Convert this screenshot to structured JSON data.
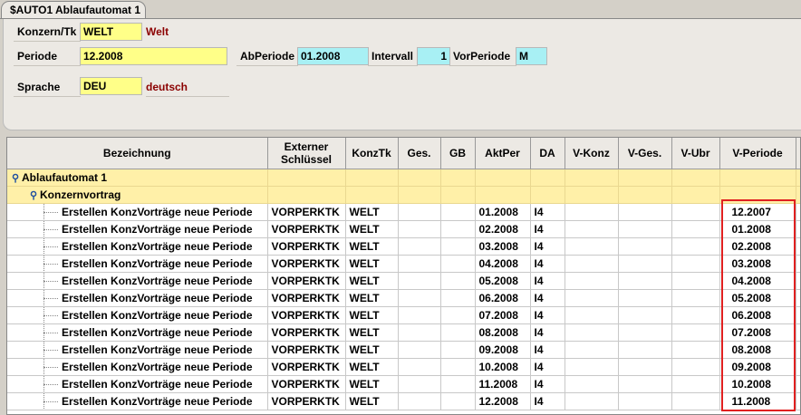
{
  "tab": {
    "title": "$AUTO1 Ablaufautomat 1"
  },
  "form": {
    "konzern": {
      "label": "Konzern/Tk",
      "value": "WELT",
      "desc": "Welt"
    },
    "periode": {
      "label": "Periode",
      "value": "12.2008"
    },
    "abperiode": {
      "label": "AbPeriode",
      "value": "01.2008"
    },
    "intervall": {
      "label": "Intervall",
      "value": "1"
    },
    "vorperiode": {
      "label": "VorPeriode",
      "value": "M"
    },
    "sprache": {
      "label": "Sprache",
      "value": "DEU",
      "desc": "deutsch"
    }
  },
  "grid": {
    "headers": [
      "Bezeichnung",
      "Externer Schlüssel",
      "KonzTk",
      "Ges.",
      "GB",
      "AktPer",
      "DA",
      "V-Konz",
      "V-Ges.",
      "V-Ubr",
      "V-Periode"
    ],
    "group1": "Ablaufautomat 1",
    "group2": "Konzernvortrag",
    "rows": [
      {
        "bez": "Erstellen KonzVorträge neue Periode",
        "key": "VORPERKTK",
        "konz": "WELT",
        "akt": "01.2008",
        "da": "I4",
        "vper": "12.2007"
      },
      {
        "bez": "Erstellen KonzVorträge neue Periode",
        "key": "VORPERKTK",
        "konz": "WELT",
        "akt": "02.2008",
        "da": "I4",
        "vper": "01.2008"
      },
      {
        "bez": "Erstellen KonzVorträge neue Periode",
        "key": "VORPERKTK",
        "konz": "WELT",
        "akt": "03.2008",
        "da": "I4",
        "vper": "02.2008"
      },
      {
        "bez": "Erstellen KonzVorträge neue Periode",
        "key": "VORPERKTK",
        "konz": "WELT",
        "akt": "04.2008",
        "da": "I4",
        "vper": "03.2008"
      },
      {
        "bez": "Erstellen KonzVorträge neue Periode",
        "key": "VORPERKTK",
        "konz": "WELT",
        "akt": "05.2008",
        "da": "I4",
        "vper": "04.2008"
      },
      {
        "bez": "Erstellen KonzVorträge neue Periode",
        "key": "VORPERKTK",
        "konz": "WELT",
        "akt": "06.2008",
        "da": "I4",
        "vper": "05.2008"
      },
      {
        "bez": "Erstellen KonzVorträge neue Periode",
        "key": "VORPERKTK",
        "konz": "WELT",
        "akt": "07.2008",
        "da": "I4",
        "vper": "06.2008"
      },
      {
        "bez": "Erstellen KonzVorträge neue Periode",
        "key": "VORPERKTK",
        "konz": "WELT",
        "akt": "08.2008",
        "da": "I4",
        "vper": "07.2008"
      },
      {
        "bez": "Erstellen KonzVorträge neue Periode",
        "key": "VORPERKTK",
        "konz": "WELT",
        "akt": "09.2008",
        "da": "I4",
        "vper": "08.2008"
      },
      {
        "bez": "Erstellen KonzVorträge neue Periode",
        "key": "VORPERKTK",
        "konz": "WELT",
        "akt": "10.2008",
        "da": "I4",
        "vper": "09.2008"
      },
      {
        "bez": "Erstellen KonzVorträge neue Periode",
        "key": "VORPERKTK",
        "konz": "WELT",
        "akt": "11.2008",
        "da": "I4",
        "vper": "10.2008"
      },
      {
        "bez": "Erstellen KonzVorträge neue Periode",
        "key": "VORPERKTK",
        "konz": "WELT",
        "akt": "12.2008",
        "da": "I4",
        "vper": "11.2008"
      }
    ]
  }
}
